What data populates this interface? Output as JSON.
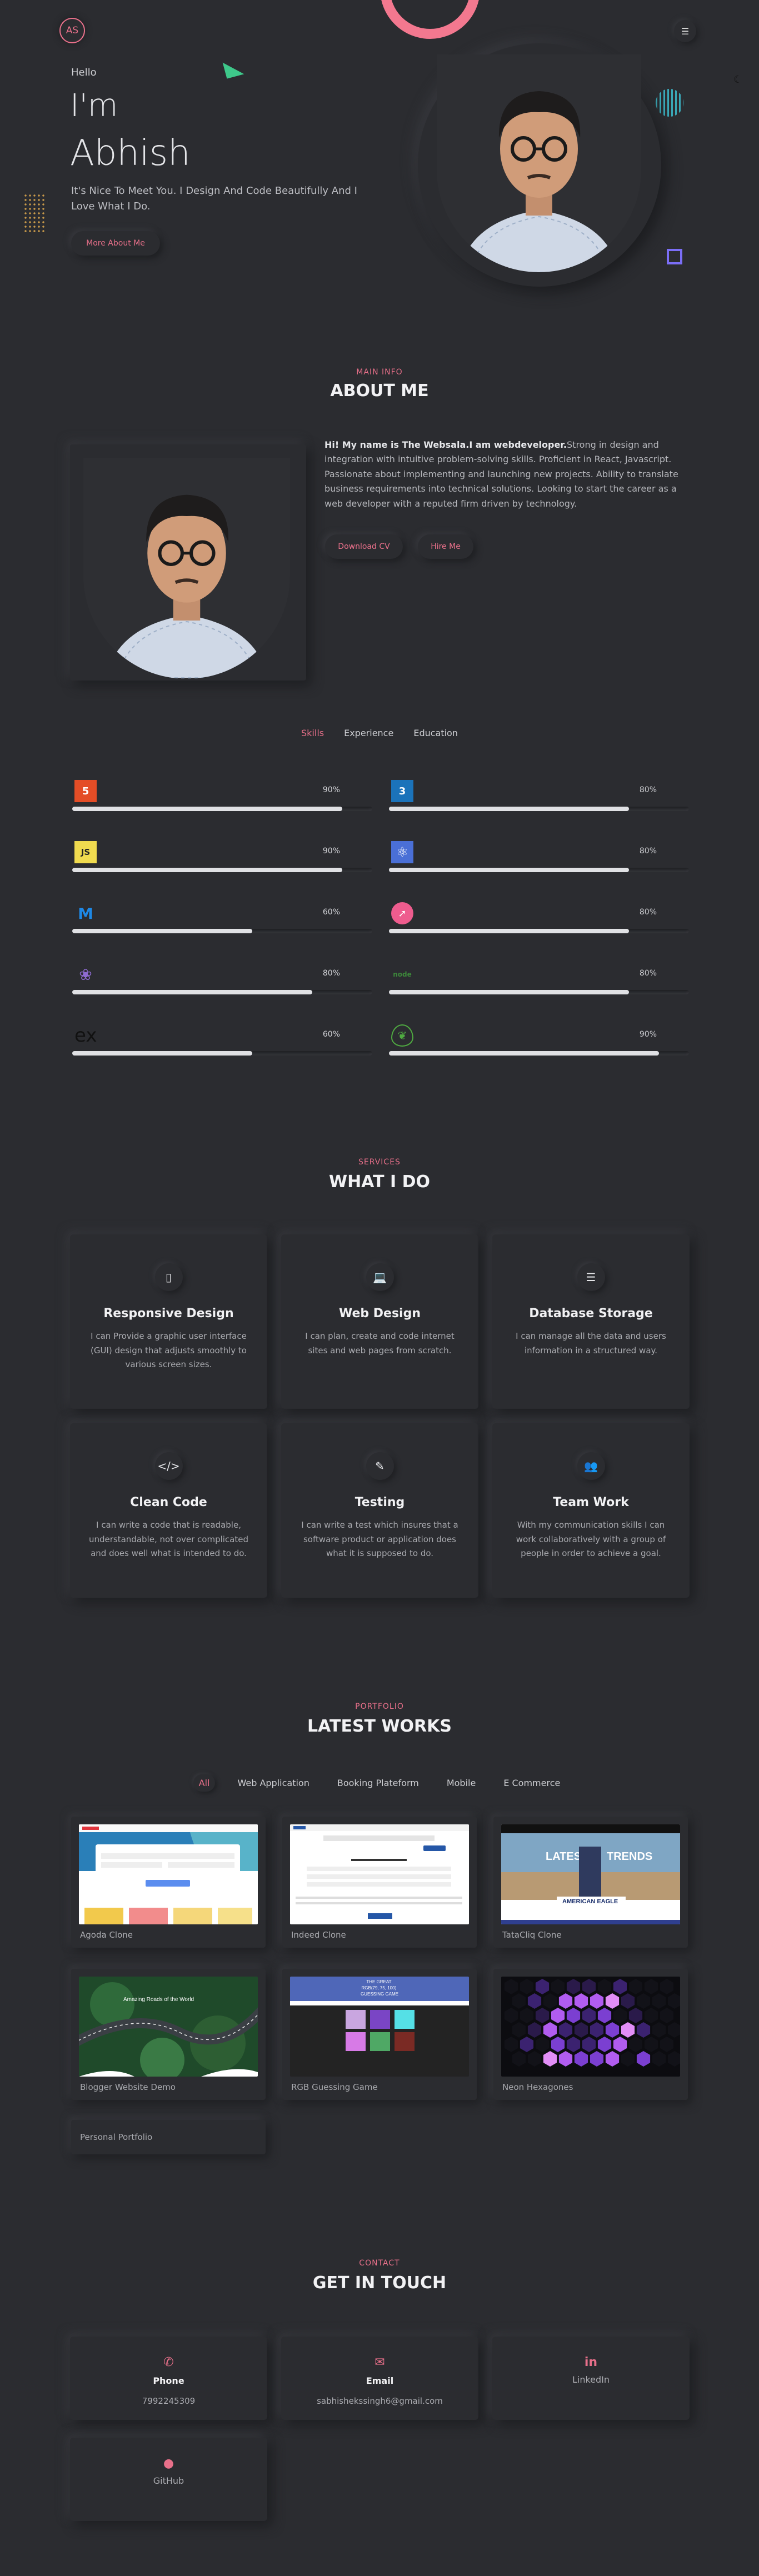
{
  "header": {
    "logo": "AS",
    "menu_icon": "☰",
    "theme_icon": "☾"
  },
  "hero": {
    "hello": "Hello",
    "im": "I'm",
    "name": "Abhish",
    "tagline": "It's Nice To Meet You. I Design And Code Beautifully And I Love What I Do.",
    "button": "More About Me"
  },
  "about": {
    "sub": "MAIN INFO",
    "title": "ABOUT ME",
    "intro_bold": "Hi! My name is The Websala.I am webdeveloper.",
    "intro_rest": "Strong in design and integration with intuitive problem-solving skills. Proficient in React, Javascript. Passionate about implementing and launching new projects. Ability to translate business requirements into technical solutions. Looking to start the career as a web developer with a reputed firm driven by technology.",
    "download_button": "Download CV",
    "hire_button": "Hire Me",
    "tabs": [
      "Skills",
      "Experience",
      "Education"
    ],
    "active_tab": "Skills"
  },
  "skills": [
    {
      "icon": "html5-icon",
      "label": "5",
      "percent_text": "90%",
      "level": 0.9,
      "color": "#e44d26"
    },
    {
      "icon": "css3-icon",
      "label": "3",
      "percent_text": "80%",
      "level": 0.8,
      "color": "#1b73ba"
    },
    {
      "icon": "javascript-icon",
      "label": "JS",
      "percent_text": "90%",
      "level": 0.9,
      "color": "#f0db4f"
    },
    {
      "icon": "react-icon",
      "label": "⚛",
      "percent_text": "80%",
      "level": 0.8,
      "color": "#4a6fd6"
    },
    {
      "icon": "mui-icon",
      "label": "M",
      "percent_text": "60%",
      "level": 0.6,
      "color": "#1e88e5"
    },
    {
      "icon": "compass-icon",
      "label": "➚",
      "percent_text": "80%",
      "level": 0.8,
      "color": "#ee5c8e"
    },
    {
      "icon": "redux-icon",
      "label": "❀",
      "percent_text": "80%",
      "level": 0.8,
      "color": "#8e6bd1"
    },
    {
      "icon": "nodejs-icon",
      "label": "node",
      "percent_text": "80%",
      "level": 0.8,
      "color": "#3c873a"
    },
    {
      "icon": "express-icon",
      "label": "ex",
      "percent_text": "60%",
      "level": 0.6,
      "color": "#111111"
    },
    {
      "icon": "mongodb-icon",
      "label": "❦",
      "percent_text": "90%",
      "level": 0.9,
      "color": "#4faa41"
    }
  ],
  "services": {
    "sub": "SERVICES",
    "title": "WHAT I DO",
    "items": [
      {
        "icon": "mobile-icon",
        "glyph": "▯",
        "title": "Responsive Design",
        "text": "I can Provide a graphic user interface (GUI) design that adjusts smoothly to various screen sizes."
      },
      {
        "icon": "laptop-icon",
        "glyph": "💻",
        "title": "Web Design",
        "text": "I can plan, create and code internet sites and web pages from scratch."
      },
      {
        "icon": "database-icon",
        "glyph": "☰",
        "title": "Database Storage",
        "text": "I can manage all the data and users information in a structured way."
      },
      {
        "icon": "code-icon",
        "glyph": "</>",
        "title": "Clean Code",
        "text": "I can write a code that is readable, understandable, not over complicated and does well what is intended to do."
      },
      {
        "icon": "syringe-icon",
        "glyph": "✎",
        "title": "Testing",
        "text": "I can write a test which insures that a software product or application does what it is supposed to do."
      },
      {
        "icon": "users-icon",
        "glyph": "👥",
        "title": "Team Work",
        "text": "With my communication skills I can work collaboratively with a group of people in order to achieve a goal."
      }
    ]
  },
  "portfolio": {
    "sub": "PORTFOLIO",
    "title": "LATEST WORKS",
    "filters": [
      "All",
      "Web Application",
      "Booking Plateform",
      "Mobile",
      "E Commerce"
    ],
    "active_filter": "All",
    "works": [
      {
        "title": "Agoda Clone",
        "thumb": "agoda"
      },
      {
        "title": "Indeed Clone",
        "thumb": "indeed"
      },
      {
        "title": "TataCliq Clone",
        "thumb": "tatacliq"
      },
      {
        "title": "Blogger Website Demo",
        "thumb": "blogger"
      },
      {
        "title": "RGB Guessing Game",
        "thumb": "rgb"
      },
      {
        "title": "Neon Hexagones",
        "thumb": "neon"
      },
      {
        "title": "Personal Portfolio",
        "thumb": "none"
      }
    ],
    "thumb_text": {
      "tatacliq_latest": "LATEST",
      "tatacliq_trends": "TRENDS",
      "tatacliq_brand": "AMERICAN EAGLE",
      "blogger_caption": "Amazing Roads of the World",
      "rgb_heading": "THE GREAT\nRGB(79, 75, 100)\nGUESSING GAME"
    }
  },
  "contact": {
    "sub": "CONTACT",
    "title": "GET IN TOUCH",
    "cards": [
      {
        "icon": "phone-icon",
        "glyph": "✆",
        "label": "Phone",
        "value": "7992245309"
      },
      {
        "icon": "email-icon",
        "glyph": "✉",
        "label": "Email",
        "value": "sabhishekssingh6@gmail.com"
      },
      {
        "icon": "linkedin-icon",
        "glyph": "in",
        "label": "LinkedIn",
        "value": ""
      },
      {
        "icon": "github-icon",
        "glyph": "●",
        "label": "GitHub",
        "value": ""
      }
    ]
  }
}
